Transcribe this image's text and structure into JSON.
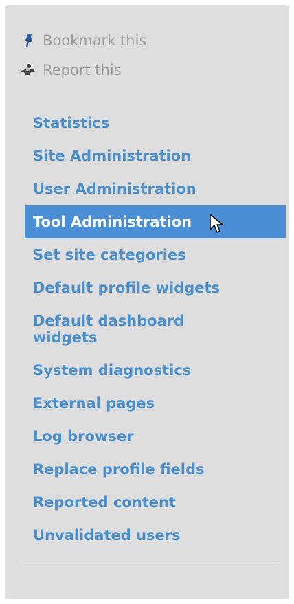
{
  "actions": {
    "bookmark": {
      "label": "Bookmark this",
      "icon": "pushpin-icon"
    },
    "report": {
      "label": "Report this",
      "icon": "report-icon"
    }
  },
  "menu": {
    "items": [
      {
        "label": "Statistics"
      },
      {
        "label": "Site Administration"
      },
      {
        "label": "User Administration"
      },
      {
        "label": "Tool Administration",
        "selected": true
      },
      {
        "label": "Set site categories"
      },
      {
        "label": "Default profile widgets"
      },
      {
        "label": "Default dashboard widgets"
      },
      {
        "label": "System diagnostics"
      },
      {
        "label": "External pages"
      },
      {
        "label": "Log browser"
      },
      {
        "label": "Replace profile fields"
      },
      {
        "label": "Reported content"
      },
      {
        "label": "Unvalidated users"
      }
    ]
  },
  "colors": {
    "panel_bg": "#dedede",
    "link": "#4a8fcb",
    "selected_bg": "#4a8fd6",
    "muted": "#9a9a9a"
  }
}
